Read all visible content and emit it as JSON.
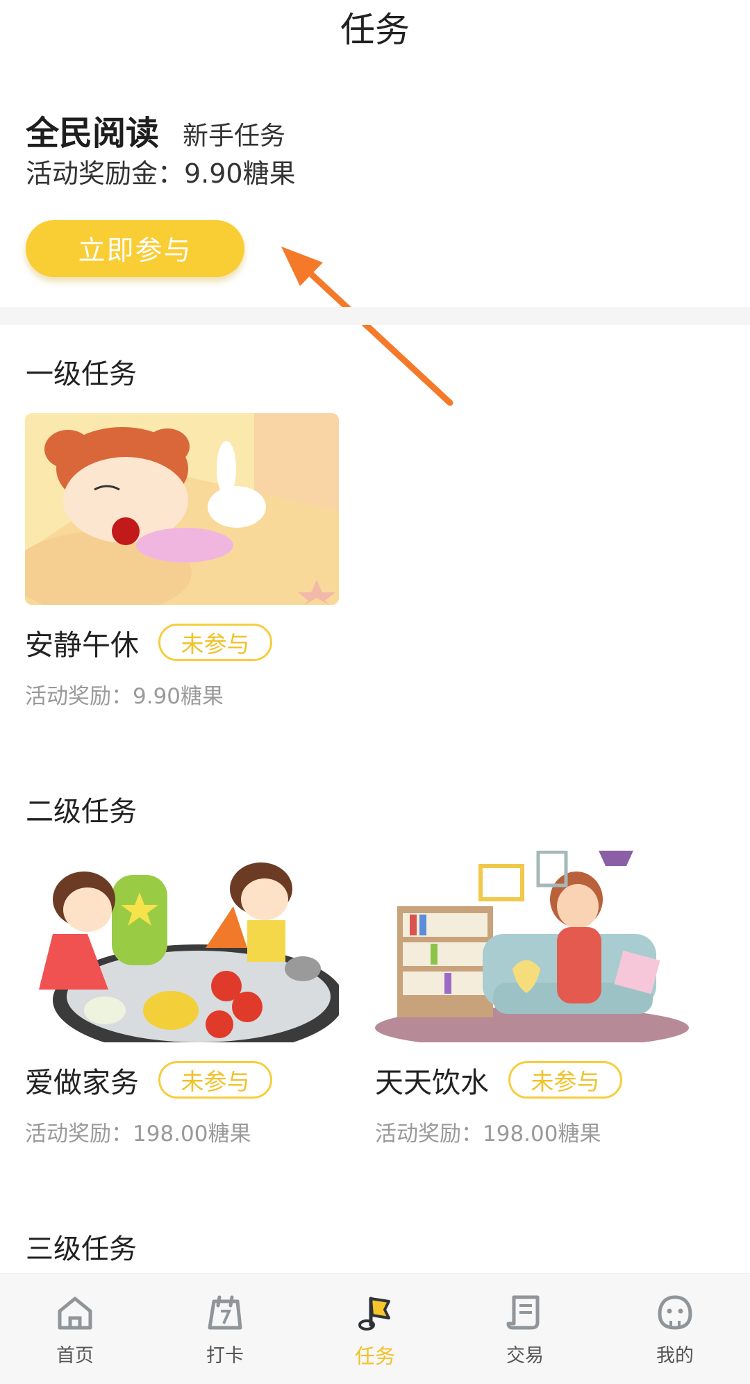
{
  "header": {
    "title": "任务"
  },
  "promo": {
    "title": "全民阅读",
    "subtitle": "新手任务",
    "reward": "活动奖励金：9.90糖果",
    "join_label": "立即参与"
  },
  "levels": [
    {
      "title": "一级任务",
      "tasks": [
        {
          "name": "安静午休",
          "status": "未参与",
          "reward": "活动奖励：9.90糖果"
        }
      ]
    },
    {
      "title": "二级任务",
      "tasks": [
        {
          "name": "爱做家务",
          "status": "未参与",
          "reward": "活动奖励：198.00糖果"
        },
        {
          "name": "天天饮水",
          "status": "未参与",
          "reward": "活动奖励：198.00糖果"
        }
      ]
    },
    {
      "title": "三级任务",
      "tasks": []
    }
  ],
  "tabbar": {
    "items": [
      {
        "label": "首页",
        "icon": "home-icon"
      },
      {
        "label": "打卡",
        "icon": "calendar-icon"
      },
      {
        "label": "任务",
        "icon": "task-flag-icon",
        "active": true
      },
      {
        "label": "交易",
        "icon": "scroll-icon"
      },
      {
        "label": "我的",
        "icon": "profile-icon"
      }
    ]
  },
  "colors": {
    "accent": "#f9cd34",
    "arrow": "#f47a2a",
    "muted_text": "#9a9a9a"
  }
}
